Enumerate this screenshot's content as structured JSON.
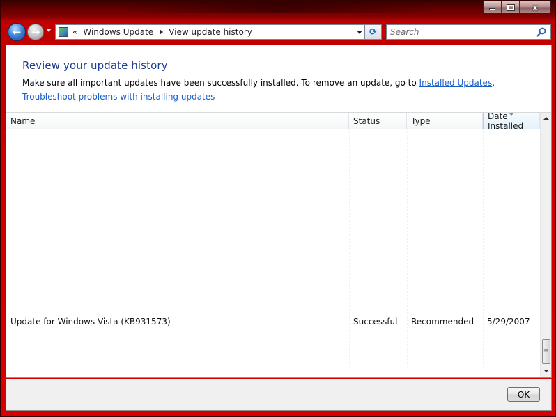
{
  "window": {
    "minimize_label": "",
    "maximize_label": "",
    "close_label": "x"
  },
  "nav": {
    "back_glyph": "←",
    "forward_glyph": "→",
    "breadcrumb_overflow": "«",
    "breadcrumbs": [
      "Windows Update",
      "View update history"
    ],
    "refresh_glyph": "⟳"
  },
  "search": {
    "placeholder": "Search"
  },
  "page": {
    "title": "Review your update history",
    "instruction_prefix": "Make sure all important updates have been successfully installed. To remove an update, go to ",
    "installed_updates_link": "Installed Updates",
    "instruction_suffix": ".",
    "troubleshoot_link": "Troubleshoot problems with installing updates"
  },
  "table": {
    "columns": {
      "name": "Name",
      "status": "Status",
      "type": "Type",
      "date_installed": "Date Installed"
    },
    "sorted_column": "date_installed",
    "rows": [
      {
        "name": "Update for Windows Vista (KB931573)",
        "status": "Successful",
        "type": "Recommended",
        "date_installed": "5/29/2007"
      }
    ]
  },
  "footer": {
    "ok_label": "OK"
  },
  "colors": {
    "frame": "#c80000",
    "title_text": "#1e3e8c",
    "link": "#1a5ec8"
  }
}
